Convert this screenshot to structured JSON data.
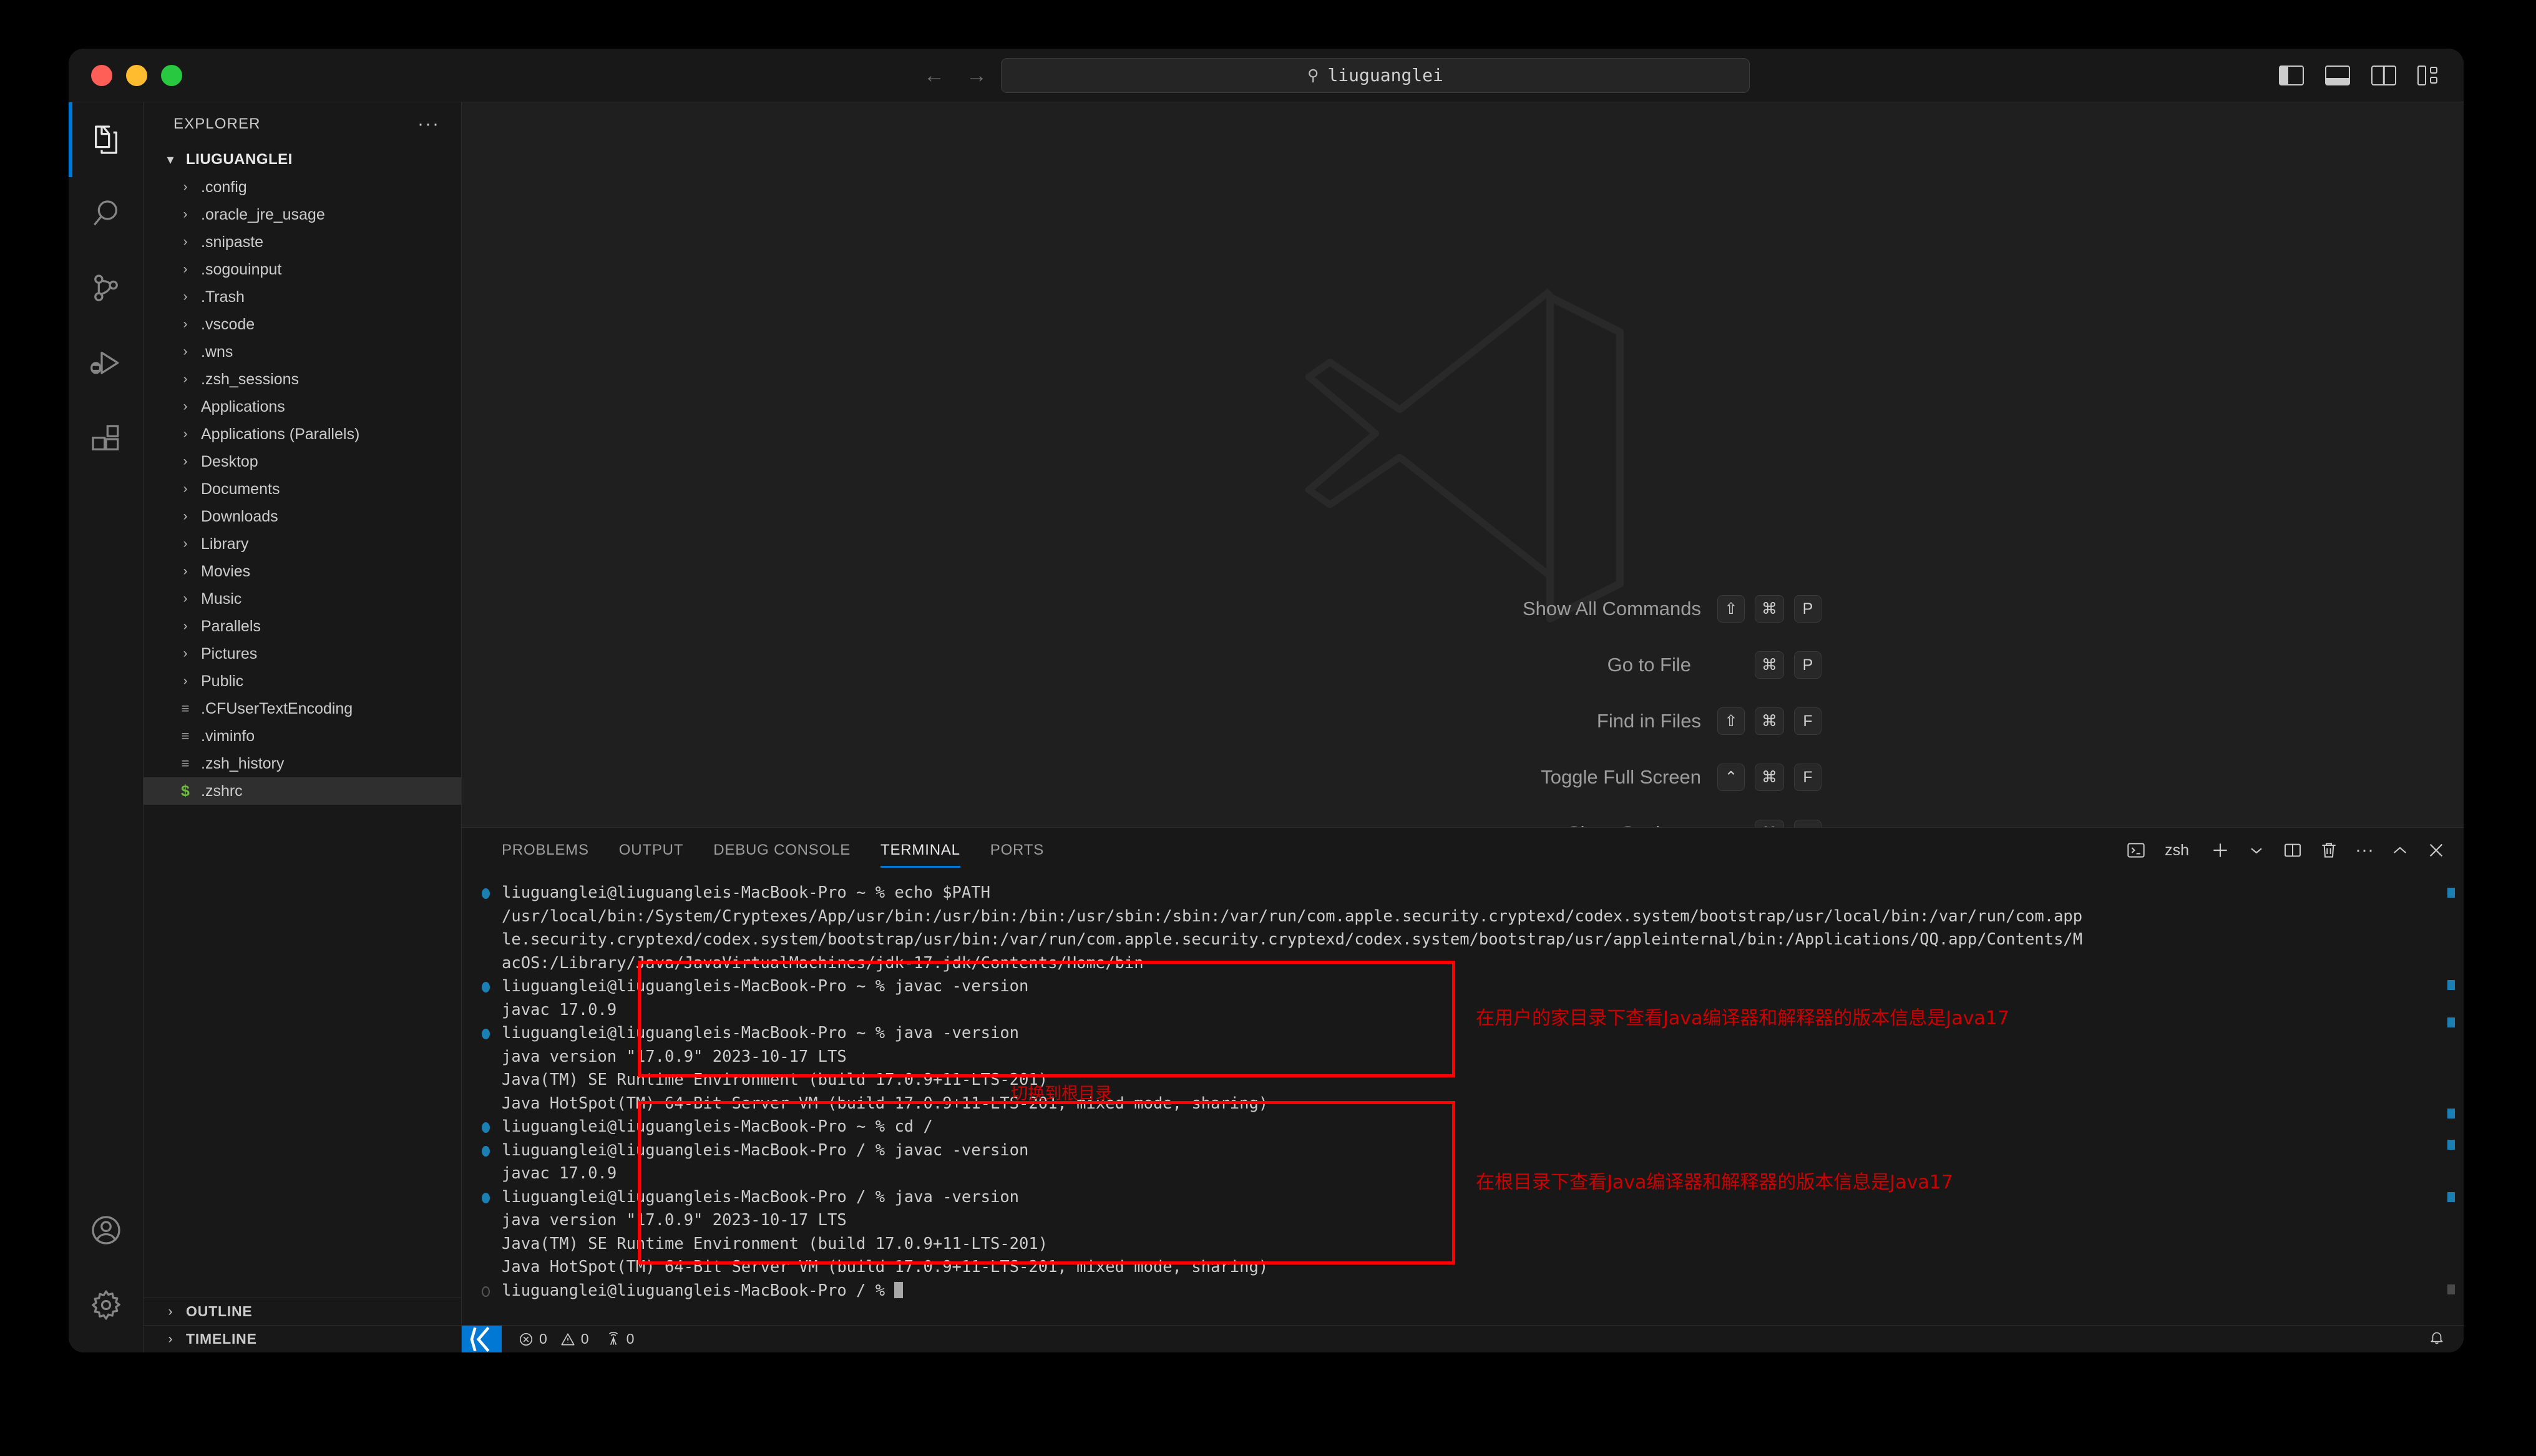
{
  "window": {
    "traffic_lights": [
      "close",
      "minimize",
      "maximize"
    ],
    "search_value": "liuguanglei",
    "search_icon": "search-icon",
    "nav_back": "←",
    "nav_forward": "→"
  },
  "activity_bar": {
    "items": [
      {
        "name": "explorer",
        "icon": "files-icon",
        "active": true
      },
      {
        "name": "search",
        "icon": "search-icon",
        "active": false
      },
      {
        "name": "source-control",
        "icon": "source-control-icon",
        "active": false
      },
      {
        "name": "run-and-debug",
        "icon": "debug-icon",
        "active": false
      },
      {
        "name": "extensions",
        "icon": "extensions-icon",
        "active": false
      }
    ],
    "bottom": [
      {
        "name": "accounts",
        "icon": "account-icon"
      },
      {
        "name": "manage",
        "icon": "gear-icon"
      }
    ]
  },
  "sidebar": {
    "title": "EXPLORER",
    "more_actions": "···",
    "root_folder": "LIUGUANGLEI",
    "items": [
      {
        "label": ".config",
        "type": "folder"
      },
      {
        "label": ".oracle_jre_usage",
        "type": "folder"
      },
      {
        "label": ".snipaste",
        "type": "folder"
      },
      {
        "label": ".sogouinput",
        "type": "folder"
      },
      {
        "label": ".Trash",
        "type": "folder"
      },
      {
        "label": ".vscode",
        "type": "folder"
      },
      {
        "label": ".wns",
        "type": "folder"
      },
      {
        "label": ".zsh_sessions",
        "type": "folder"
      },
      {
        "label": "Applications",
        "type": "folder"
      },
      {
        "label": "Applications (Parallels)",
        "type": "folder"
      },
      {
        "label": "Desktop",
        "type": "folder"
      },
      {
        "label": "Documents",
        "type": "folder"
      },
      {
        "label": "Downloads",
        "type": "folder"
      },
      {
        "label": "Library",
        "type": "folder"
      },
      {
        "label": "Movies",
        "type": "folder"
      },
      {
        "label": "Music",
        "type": "folder"
      },
      {
        "label": "Parallels",
        "type": "folder"
      },
      {
        "label": "Pictures",
        "type": "folder"
      },
      {
        "label": "Public",
        "type": "folder"
      },
      {
        "label": ".CFUserTextEncoding",
        "type": "file"
      },
      {
        "label": ".viminfo",
        "type": "file"
      },
      {
        "label": ".zsh_history",
        "type": "file"
      },
      {
        "label": ".zshrc",
        "type": "file-shell",
        "selected": true
      }
    ],
    "sections": [
      {
        "label": "OUTLINE"
      },
      {
        "label": "TIMELINE"
      }
    ]
  },
  "editor_welcome": {
    "shortcuts": [
      {
        "label": "Show All Commands",
        "keys": [
          "⇧",
          "⌘",
          "P"
        ]
      },
      {
        "label": "Go to File",
        "keys": [
          "⌘",
          "P"
        ]
      },
      {
        "label": "Find in Files",
        "keys": [
          "⇧",
          "⌘",
          "F"
        ]
      },
      {
        "label": "Toggle Full Screen",
        "keys": [
          "⌃",
          "⌘",
          "F"
        ]
      },
      {
        "label": "Show Settings",
        "keys": [
          "⌘",
          ","
        ]
      }
    ]
  },
  "panel": {
    "tabs": [
      {
        "label": "PROBLEMS",
        "active": false
      },
      {
        "label": "OUTPUT",
        "active": false
      },
      {
        "label": "DEBUG CONSOLE",
        "active": false
      },
      {
        "label": "TERMINAL",
        "active": true
      },
      {
        "label": "PORTS",
        "active": false
      }
    ],
    "shell_label": "zsh",
    "actions": [
      {
        "name": "terminal-icon"
      },
      {
        "name": "new-terminal-icon",
        "glyph": "+"
      },
      {
        "name": "chevron-down-icon",
        "glyph": "⌄"
      },
      {
        "name": "split-terminal-icon"
      },
      {
        "name": "kill-terminal-icon"
      },
      {
        "name": "more-actions-icon",
        "glyph": "···"
      },
      {
        "name": "maximize-panel-icon",
        "glyph": "⌃"
      },
      {
        "name": "close-panel-icon",
        "glyph": "✕"
      }
    ]
  },
  "terminal": {
    "lines": [
      {
        "text": "liuguanglei@liuguangleis-MacBook-Pro ~ % echo $PATH",
        "deco": "ok"
      },
      {
        "text": "/usr/local/bin:/System/Cryptexes/App/usr/bin:/usr/bin:/bin:/usr/sbin:/sbin:/var/run/com.apple.security.cryptexd/codex.system/bootstrap/usr/local/bin:/var/run/com.app",
        "deco": "none"
      },
      {
        "text": "le.security.cryptexd/codex.system/bootstrap/usr/bin:/var/run/com.apple.security.cryptexd/codex.system/bootstrap/usr/appleinternal/bin:/Applications/QQ.app/Contents/M",
        "deco": "none"
      },
      {
        "text": "acOS:/Library/Java/JavaVirtualMachines/jdk-17.jdk/Contents/Home/bin",
        "deco": "none"
      },
      {
        "text": "liuguanglei@liuguangleis-MacBook-Pro ~ % javac -version",
        "deco": "ok"
      },
      {
        "text": "javac 17.0.9",
        "deco": "none"
      },
      {
        "text": "liuguanglei@liuguangleis-MacBook-Pro ~ % java -version",
        "deco": "ok"
      },
      {
        "text": "java version \"17.0.9\" 2023-10-17 LTS",
        "deco": "none"
      },
      {
        "text": "Java(TM) SE Runtime Environment (build 17.0.9+11-LTS-201)",
        "deco": "none"
      },
      {
        "text": "Java HotSpot(TM) 64-Bit Server VM (build 17.0.9+11-LTS-201, mixed mode, sharing)",
        "deco": "none"
      },
      {
        "text": "liuguanglei@liuguangleis-MacBook-Pro ~ % cd /",
        "deco": "ok"
      },
      {
        "text": "liuguanglei@liuguangleis-MacBook-Pro / % javac -version",
        "deco": "ok"
      },
      {
        "text": "javac 17.0.9",
        "deco": "none"
      },
      {
        "text": "liuguanglei@liuguangleis-MacBook-Pro / % java -version",
        "deco": "ok"
      },
      {
        "text": "java version \"17.0.9\" 2023-10-17 LTS",
        "deco": "none"
      },
      {
        "text": "Java(TM) SE Runtime Environment (build 17.0.9+11-LTS-201)",
        "deco": "none"
      },
      {
        "text": "Java HotSpot(TM) 64-Bit Server VM (build 17.0.9+11-LTS-201, mixed mode, sharing)",
        "deco": "none"
      },
      {
        "text": "liuguanglei@liuguangleis-MacBook-Pro / % ",
        "deco": "idle",
        "cursor": true
      }
    ],
    "annotations": [
      {
        "name": "annotation-home-dir",
        "text": "在用户的家目录下查看Java编译器和解释器的版本信息是Java17",
        "color": "#cc0000"
      },
      {
        "name": "annotation-cd-root",
        "text": "切换到根目录",
        "color": "#cc0000"
      },
      {
        "name": "annotation-root-dir",
        "text": "在根目录下查看Java编译器和解释器的版本信息是Java17",
        "color": "#cc0000"
      }
    ],
    "highlight_color": "#ff0000"
  },
  "status_bar": {
    "remote_icon": "remote-indicator-icon",
    "errors": "0",
    "warnings": "0",
    "ports": "0",
    "bell_icon": "bell-icon"
  }
}
